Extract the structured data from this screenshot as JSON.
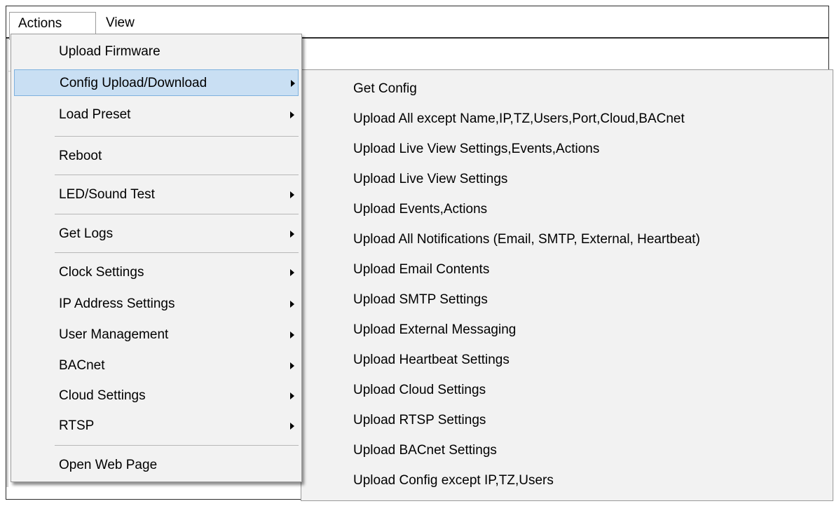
{
  "menubar": {
    "items": [
      {
        "label": "Actions"
      },
      {
        "label": "View"
      }
    ]
  },
  "actions_menu": {
    "items": [
      {
        "label": "Upload Firmware",
        "has_submenu": false
      },
      {
        "label": "Config Upload/Download",
        "has_submenu": true,
        "selected": true
      },
      {
        "label": "Load Preset",
        "has_submenu": true
      },
      {
        "label": "Reboot",
        "has_submenu": false
      },
      {
        "label": "LED/Sound Test",
        "has_submenu": true
      },
      {
        "label": "Get Logs",
        "has_submenu": true
      },
      {
        "label": "Clock Settings",
        "has_submenu": true
      },
      {
        "label": "IP Address Settings",
        "has_submenu": true
      },
      {
        "label": "User Management",
        "has_submenu": true
      },
      {
        "label": "BACnet",
        "has_submenu": true
      },
      {
        "label": "Cloud Settings",
        "has_submenu": true
      },
      {
        "label": "RTSP",
        "has_submenu": true
      },
      {
        "label": "Open Web Page",
        "has_submenu": false
      }
    ]
  },
  "config_submenu": {
    "items": [
      {
        "label": "Get Config"
      },
      {
        "label": "Upload All except Name,IP,TZ,Users,Port,Cloud,BACnet"
      },
      {
        "label": "Upload Live View Settings,Events,Actions"
      },
      {
        "label": "Upload Live View Settings"
      },
      {
        "label": "Upload Events,Actions"
      },
      {
        "label": "Upload All Notifications (Email, SMTP, External, Heartbeat)"
      },
      {
        "label": "Upload Email Contents"
      },
      {
        "label": "Upload SMTP Settings"
      },
      {
        "label": "Upload External Messaging"
      },
      {
        "label": "Upload Heartbeat Settings"
      },
      {
        "label": "Upload Cloud Settings"
      },
      {
        "label": "Upload RTSP Settings"
      },
      {
        "label": "Upload BACnet Settings"
      },
      {
        "label": "Upload Config except IP,TZ,Users"
      }
    ]
  },
  "colors": {
    "menu_background": "#f2f2f2",
    "selected_background": "#c9dff3",
    "selected_border": "#7eb1de"
  }
}
